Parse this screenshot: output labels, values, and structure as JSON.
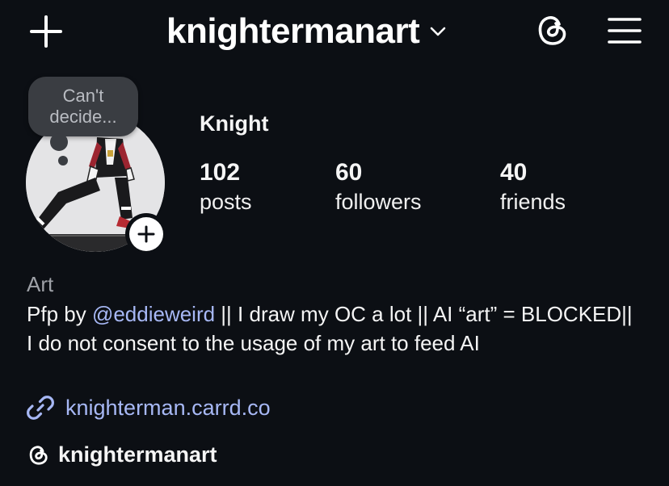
{
  "header": {
    "username": "knightermanart",
    "new_icon": "plus-icon",
    "switch_icon": "chevron-down-icon",
    "threads_icon": "threads-icon",
    "menu_icon": "hamburger-menu-icon"
  },
  "profile": {
    "note": "Can't decide...",
    "display_name": "Knight",
    "stats": [
      {
        "value": "102",
        "label": "posts"
      },
      {
        "value": "60",
        "label": "followers"
      },
      {
        "value": "40",
        "label": "friends"
      }
    ]
  },
  "bio": {
    "category": "Art",
    "prefix": "Pfp by ",
    "mention": "@eddieweird",
    "text": " || I draw my OC a lot || AI “art” = BLOCKED|| I do not consent to the usage of my art to feed AI",
    "link": "knighterman.carrd.co",
    "link_icon": "link-icon",
    "threads_handle": "knightermanart"
  },
  "colors": {
    "background": "#0c0f14",
    "link": "#a7b8f5",
    "muted": "#9ea1a7",
    "note_bubble": "#3a3d42"
  }
}
